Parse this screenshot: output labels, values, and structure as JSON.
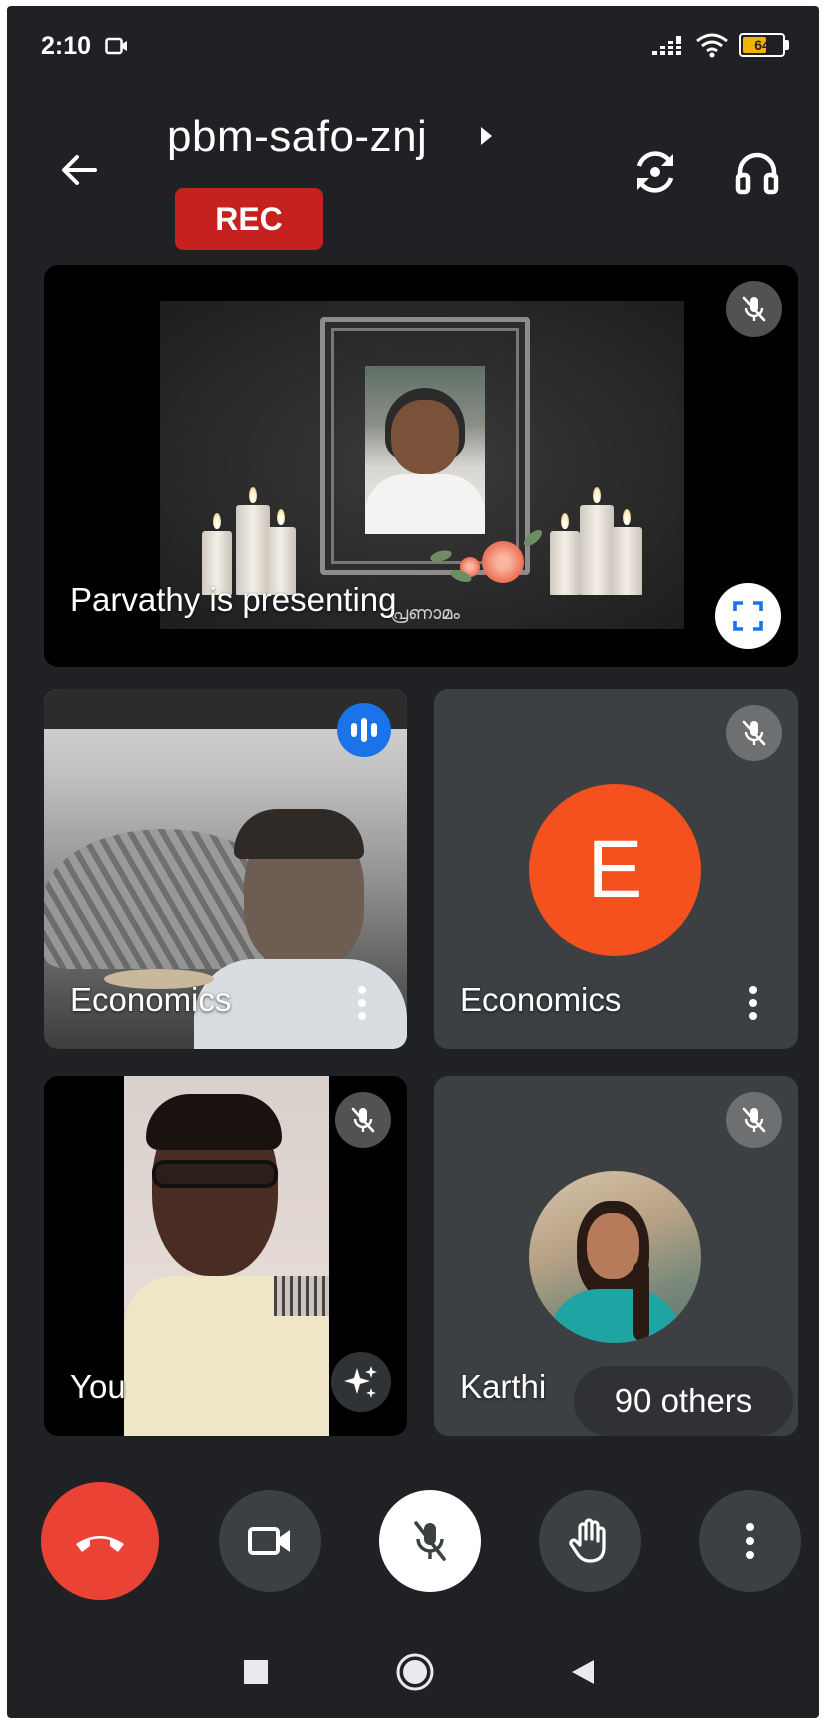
{
  "status_bar": {
    "time": "2:10",
    "battery_level": "64",
    "battery_percent": 64,
    "icons": [
      "camera-outline-icon",
      "signal-icon",
      "wifi-icon",
      "battery-icon"
    ]
  },
  "header": {
    "meeting_code": "pbm-safo-znj",
    "recording_label": "REC",
    "icons": [
      "back-arrow-icon",
      "chevron-right-icon",
      "switch-camera-icon",
      "headphones-icon"
    ]
  },
  "presentation": {
    "caption": "Parvathy is presenting",
    "slide_text": "പ്രണാമം",
    "icons": [
      "mic-off-icon",
      "fullscreen-icon"
    ]
  },
  "tiles": [
    {
      "label": "Economics",
      "state": "speaking",
      "icons": [
        "audio-levels-icon",
        "more-vertical-icon"
      ]
    },
    {
      "label": "Economics",
      "avatar_letter": "E",
      "state": "muted",
      "icons": [
        "mic-off-icon",
        "more-vertical-icon"
      ]
    },
    {
      "label": "You",
      "state": "muted",
      "icons": [
        "mic-off-icon",
        "sparkle-effects-icon"
      ]
    },
    {
      "label": "Karthi",
      "state": "muted",
      "icons": [
        "mic-off-icon"
      ]
    }
  ],
  "others": {
    "label": "90 others"
  },
  "controls": {
    "icons": [
      "end-call-icon",
      "camera-icon",
      "mic-off-icon",
      "raise-hand-icon",
      "more-vertical-icon"
    ]
  },
  "colors": {
    "background": "#202124",
    "tile": "#3c4043",
    "rec": "#c5221f",
    "end_call": "#ea4335",
    "avatar_e": "#f4511e",
    "speaking": "#1a73e8",
    "battery": "#f2b300"
  }
}
